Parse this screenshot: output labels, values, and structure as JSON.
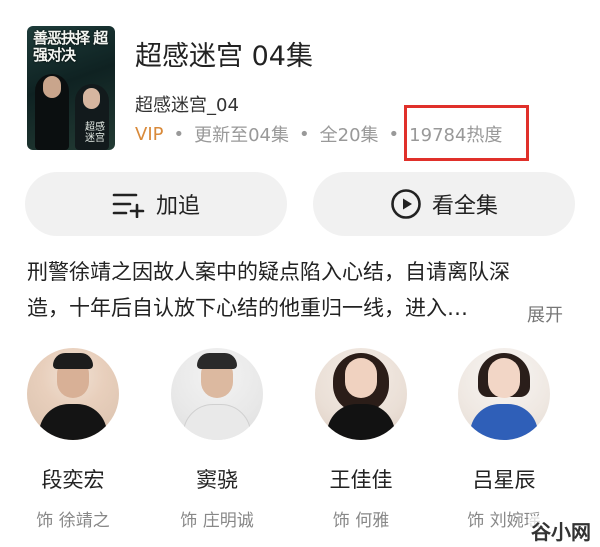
{
  "show": {
    "title": "超感迷宫 04集",
    "subtitle": "超感迷宫_04",
    "poster": {
      "title_text": "善恶抉择 超强对决",
      "logo_text": "超感迷宫"
    }
  },
  "meta": {
    "vip": "VIP",
    "separator": "•",
    "updated": "更新至04集",
    "total": "全20集",
    "popularity": "19784热度"
  },
  "actions": {
    "follow_label": "加追",
    "watch_all_label": "看全集"
  },
  "description": {
    "line1": "刑警徐靖之因故人案中的疑点陷入心结，自请离队深",
    "line2": "造，十年后自认放下心结的他重归一线，进入…",
    "expand_label": "展开"
  },
  "cast": [
    {
      "name": "段奕宏",
      "role": "饰 徐靖之"
    },
    {
      "name": "窦骁",
      "role": "饰 庄明诚"
    },
    {
      "name": "王佳佳",
      "role": "饰 何雅"
    },
    {
      "name": "吕星辰",
      "role": "饰 刘婉瑶"
    }
  ],
  "watermark": "谷小网",
  "colors": {
    "vip": "#d98a3a",
    "highlight_box": "#e0302a",
    "button_bg": "#f1f1f1"
  }
}
